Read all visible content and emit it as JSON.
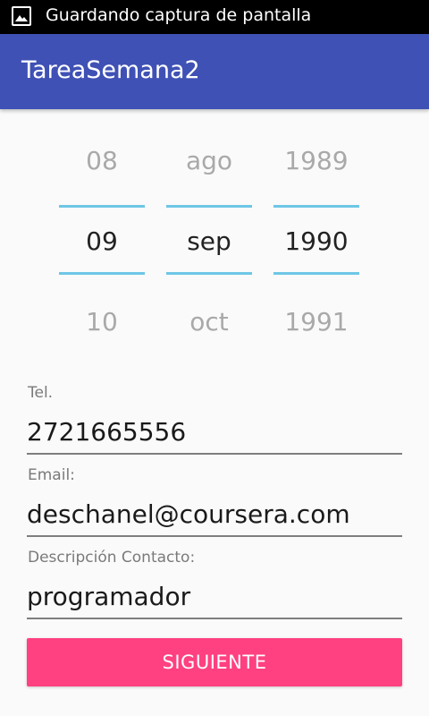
{
  "status_bar": {
    "text": "Guardando captura de pantalla",
    "icon": "image-icon"
  },
  "app_bar": {
    "title": "TareaSemana2"
  },
  "date_picker": {
    "day": {
      "prev": "08",
      "selected": "09",
      "next": "10"
    },
    "month": {
      "prev": "ago",
      "selected": "sep",
      "next": "oct"
    },
    "year": {
      "prev": "1989",
      "selected": "1990",
      "next": "1991"
    }
  },
  "form": {
    "phone": {
      "label": "Tel.",
      "value": "2721665556"
    },
    "email": {
      "label": "Email:",
      "value": "deschanel@coursera.com"
    },
    "description": {
      "label": "Descripción Contacto:",
      "value": "programador"
    }
  },
  "button": {
    "label": "SIGUIENTE"
  },
  "colors": {
    "primary": "#3f51b5",
    "accent": "#ff4081",
    "picker_divider": "#6ec6e6"
  }
}
